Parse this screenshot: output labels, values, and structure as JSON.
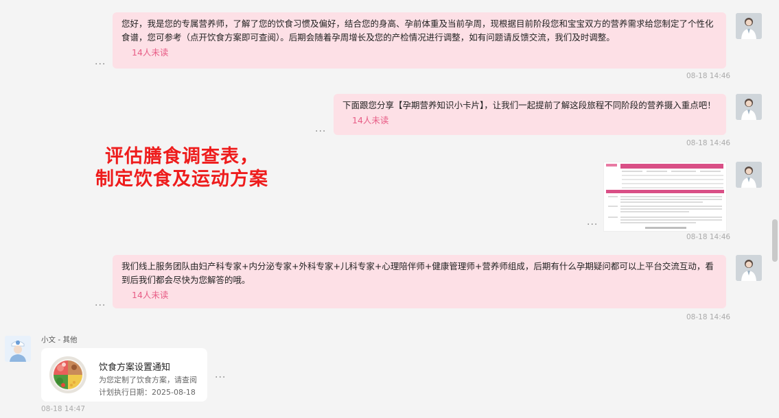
{
  "messages": [
    {
      "text": "您好，我是您的专属营养师，了解了您的饮食习惯及偏好，结合您的身高、孕前体重及当前孕周，现根据目前阶段您和宝宝双方的营养需求给您制定了个性化食谱，您可参考（点开饮食方案即可查阅）。后期会随着孕周增长及您的产检情况进行调整，如有问题请反馈交流，我们及时调整。",
      "unread": "14人未读",
      "time": "08-18 14:46"
    },
    {
      "text": "下面跟您分享【孕期营养知识小卡片】，让我们一起提前了解这段旅程不同阶段的营养摄入重点吧！",
      "unread": "14人未读",
      "time": "08-18 14:46"
    },
    {
      "time": "08-18 14:46"
    },
    {
      "text": "我们线上服务团队由妇产科专家+内分泌专家+外科专家+儿科专家+心理陪伴师+健康管理师+营养师组成，后期有什么孕期疑问都可以上平台交流互动，看到后我们都会尽快为您解答的哦。",
      "unread": "14人未读",
      "time": "08-18 14:46"
    }
  ],
  "overlay": {
    "line1": "评估膳食调查表，",
    "line2": "制定饮食及运动方案"
  },
  "incoming": {
    "sender": "小文 - 其他",
    "card_title": "饮食方案设置通知",
    "card_subtitle": "为您定制了饮食方案，请查阅",
    "card_date": "计划执行日期：2025-08-18",
    "time": "08-18 14:47"
  },
  "more_glyph": "···",
  "icons": {
    "avatar_doctor": "doctor-avatar-icon",
    "avatar_nurse": "nurse-avatar-icon",
    "food_plate": "food-plate-icon"
  },
  "colors": {
    "bubble": "#fde0e6",
    "unread": "#e85d86",
    "overlay_text": "#ee1c1c"
  }
}
